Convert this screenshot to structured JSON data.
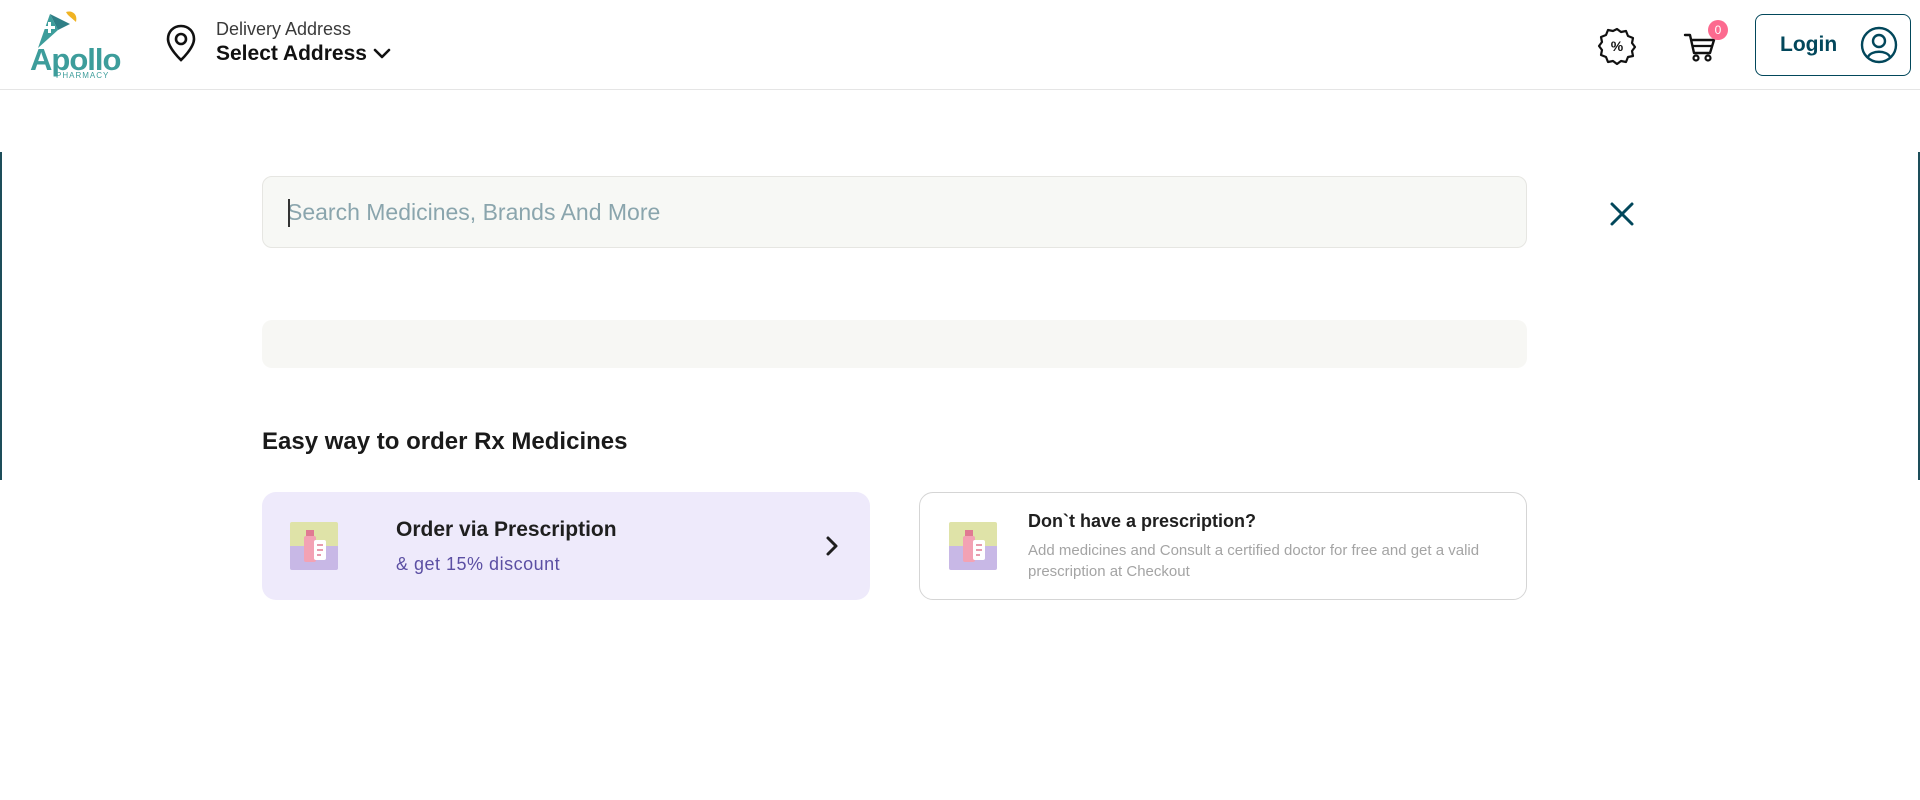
{
  "header": {
    "logo": {
      "text": "Apollo",
      "sub": "PHARMACY"
    },
    "address": {
      "label": "Delivery Address",
      "value": "Select Address"
    },
    "cart": {
      "count": "0"
    },
    "login_label": "Login"
  },
  "search": {
    "placeholder": "Search Medicines, Brands And More",
    "value": ""
  },
  "rx_section": {
    "title": "Easy way to order Rx Medicines",
    "cards": [
      {
        "title": "Order via Prescription",
        "subtitle": "& get 15% discount"
      },
      {
        "title": "Don`t have a prescription?",
        "subtitle": "Add medicines and Consult a certified doctor for free and get a valid prescription at Checkout"
      }
    ]
  },
  "colors": {
    "brand": "#02475b",
    "logo": "#3d9d9b",
    "badge": "#fc6a8f",
    "card_highlight": "#eeeafb",
    "discount_text": "#5b4fa3"
  }
}
